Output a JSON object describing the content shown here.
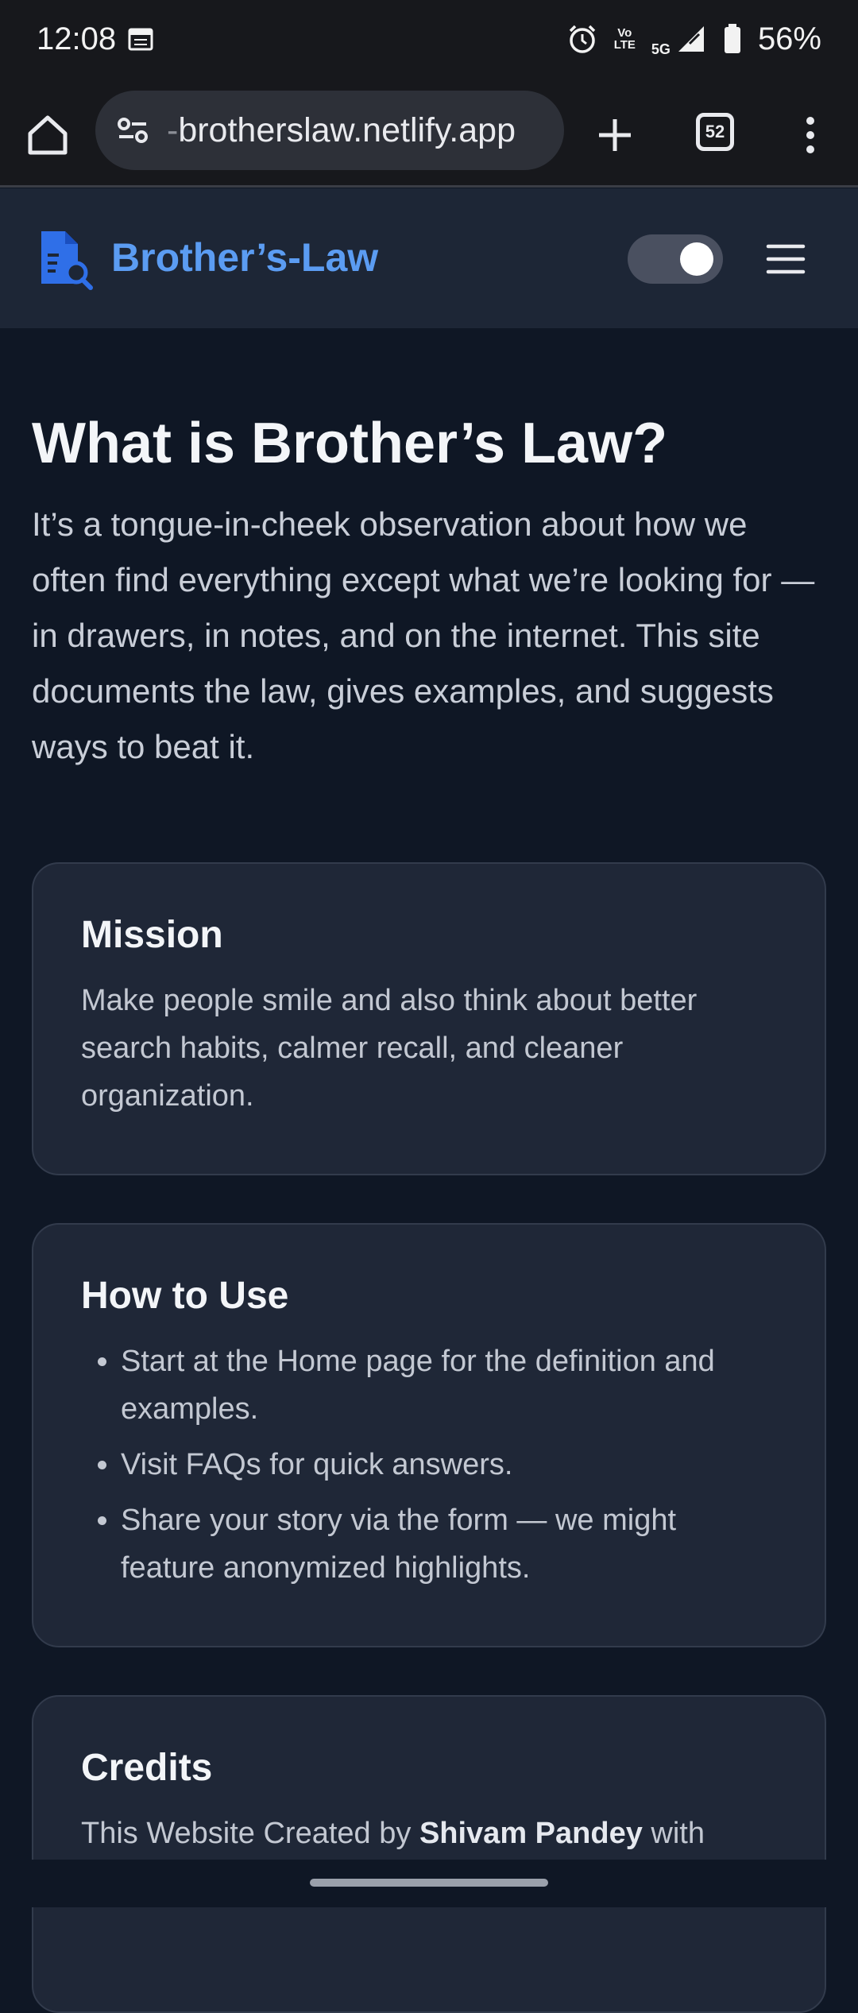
{
  "status_bar": {
    "time": "12:08",
    "battery": "56%",
    "network_volte": "Vo\nLTE",
    "network_type": "5G"
  },
  "browser": {
    "url_prefix": "-",
    "url": "brotherslaw.netlify.app",
    "tab_count": "52"
  },
  "site": {
    "brand": "Brother’s-Law",
    "accent_color": "#5b9cf2"
  },
  "main": {
    "title": "What is Brother’s Law?",
    "intro": "It’s a tongue-in-cheek observation about how we often find everything except what we’re looking for — in drawers, in notes, and on the internet. This site documents the law, gives examples, and suggests ways to beat it."
  },
  "cards": {
    "mission": {
      "title": "Mission",
      "body": "Make people smile and also think about better search habits, calmer recall, and cleaner organization."
    },
    "how_to_use": {
      "title": "How to Use",
      "items": [
        "Start at the Home page for the definition and examples.",
        "Visit FAQs for quick answers.",
        "Share your story via the form — we might feature anonymized highlights."
      ]
    },
    "credits": {
      "title": "Credits",
      "body_prefix": "This Website Created by ",
      "author": "Shivam Pandey",
      "body_suffix": " with"
    }
  }
}
